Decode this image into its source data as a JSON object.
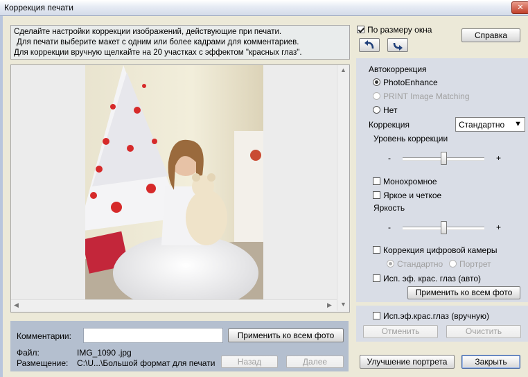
{
  "window": {
    "title": "Коррекция печати",
    "close_glyph": "✕"
  },
  "instruction": [
    "Сделайте настройки коррекции изображений, действующие при печати.",
    "Для печати выберите макет с одним или более кадрами для комментариев.",
    "Для коррекции вручную щелкайте на 20 участках с эффектом \"красных глаз\"."
  ],
  "toolbar": {
    "fit_label": "По размеру окна",
    "fit_checked": true,
    "help_label": "Справка",
    "rotate_left_icon": "rotate-left-icon",
    "rotate_right_icon": "rotate-right-icon"
  },
  "auto": {
    "heading": "Автокоррекция",
    "options": [
      {
        "label": "PhotoEnhance",
        "checked": true,
        "disabled": false
      },
      {
        "label": "PRINT Image Matching",
        "checked": false,
        "disabled": true
      },
      {
        "label": "Нет",
        "checked": false,
        "disabled": false
      }
    ]
  },
  "correction": {
    "label": "Коррекция",
    "select_value": "Стандартно",
    "level_label": "Уровень коррекции",
    "level_value": 0.5,
    "minus": "-",
    "plus": "+"
  },
  "checks": {
    "mono": "Монохромное",
    "vivid": "Яркое и четкое"
  },
  "brightness": {
    "label": "Яркость",
    "value": 0.5,
    "minus": "-",
    "plus": "+"
  },
  "camera": {
    "label": "Коррекция цифровой камеры",
    "opt_standard": "Стандартно",
    "opt_portrait": "Портрет"
  },
  "redeye": {
    "auto_label": "Исп. эф. крас. глаз (авто)",
    "apply_all": "Применить ко всем фото",
    "manual_label": "Исп.эф.крас.глаз (вручную)",
    "cancel": "Отменить",
    "clear": "Очистить"
  },
  "bottom": {
    "comments_label": "Комментарии:",
    "comments_value": "",
    "apply_all": "Применить ко всем фото",
    "file_label": "Файл:",
    "file_value": "IMG_1090 .jpg",
    "location_label": "Размещение:",
    "location_value": "C:\\U...\\Большой формат для печати",
    "back": "Назад",
    "next": "Далее"
  },
  "footer": {
    "portrait_btn": "Улучшение портрета",
    "close_btn": "Закрыть"
  },
  "colors": {
    "accent": "#3a5fa0",
    "panel": "#d9dde6",
    "bottom_panel": "#b4bfcf"
  }
}
